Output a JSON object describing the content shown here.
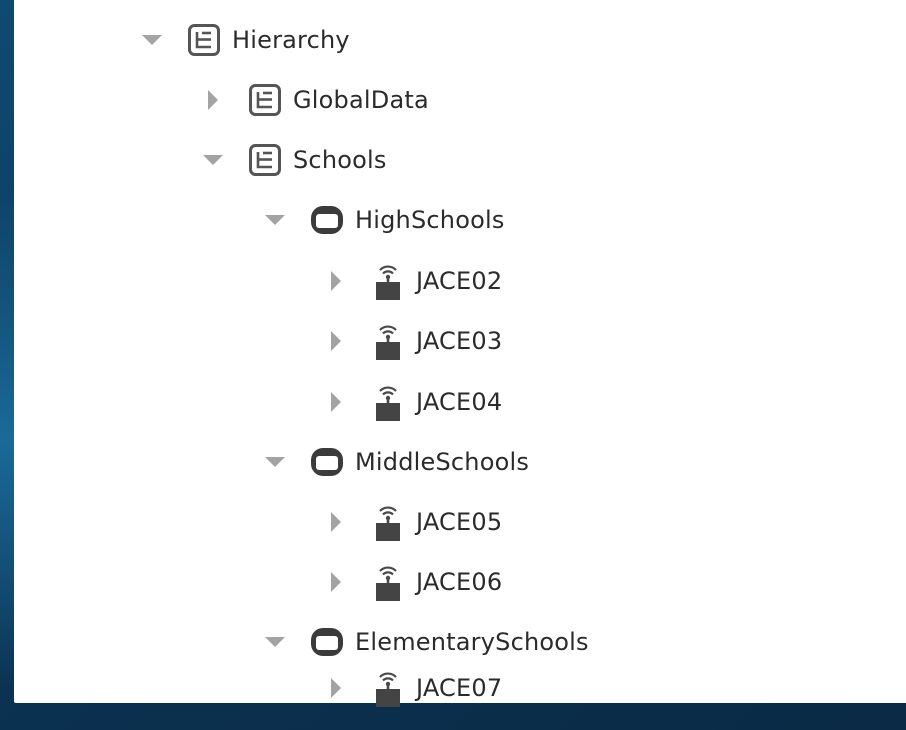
{
  "tree": {
    "root": {
      "label": "Hierarchy",
      "expanded": true,
      "icon": "hierarchy-icon"
    },
    "global_data": {
      "label": "GlobalData",
      "expanded": false,
      "icon": "hierarchy-icon"
    },
    "schools": {
      "label": "Schools",
      "expanded": true,
      "icon": "hierarchy-icon"
    },
    "high_schools": {
      "label": "HighSchools",
      "expanded": true,
      "icon": "folder-icon"
    },
    "jace02": {
      "label": "JACE02",
      "expanded": false,
      "icon": "station-icon"
    },
    "jace03": {
      "label": "JACE03",
      "expanded": false,
      "icon": "station-icon"
    },
    "jace04": {
      "label": "JACE04",
      "expanded": false,
      "icon": "station-icon"
    },
    "middle_schools": {
      "label": "MiddleSchools",
      "expanded": true,
      "icon": "folder-icon"
    },
    "jace05": {
      "label": "JACE05",
      "expanded": false,
      "icon": "station-icon"
    },
    "jace06": {
      "label": "JACE06",
      "expanded": false,
      "icon": "station-icon"
    },
    "elementary_schools": {
      "label": "ElementarySchools",
      "expanded": true,
      "icon": "folder-icon"
    },
    "jace07": {
      "label": "JACE07",
      "expanded": false,
      "icon": "station-icon"
    }
  }
}
